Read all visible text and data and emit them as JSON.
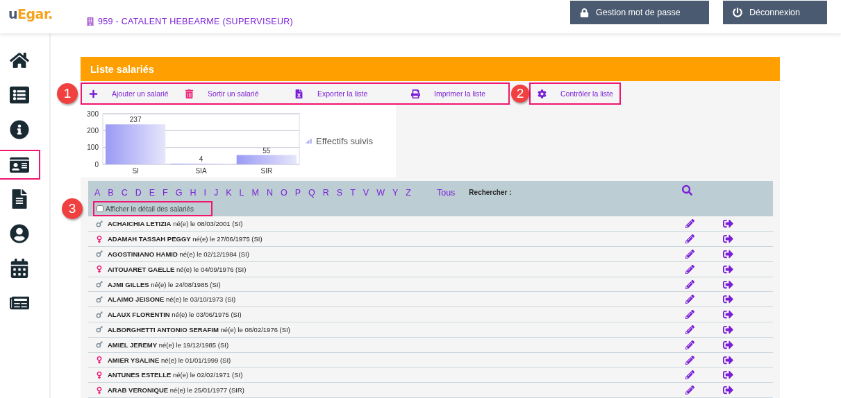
{
  "header": {
    "logo": {
      "prefix": "u",
      "rest": "Egar."
    },
    "company": "959 - CATALENT HEBEARME (SUPERVISEUR)",
    "buttons": [
      {
        "kind": "lock",
        "label": "Gestion mot de passe"
      },
      {
        "kind": "power",
        "label": "Déconnexion"
      }
    ]
  },
  "sidebar": {
    "items": [
      {
        "kind": "home",
        "highlighted": false
      },
      {
        "kind": "list",
        "highlighted": false
      },
      {
        "kind": "info",
        "highlighted": false
      },
      {
        "kind": "id-card",
        "highlighted": true
      },
      {
        "kind": "document",
        "highlighted": false
      },
      {
        "kind": "user",
        "highlighted": false
      },
      {
        "kind": "calendar",
        "highlighted": false
      },
      {
        "kind": "newspaper",
        "highlighted": false
      }
    ]
  },
  "panel": {
    "title": "Liste salariés",
    "toolbar": [
      {
        "callout": "1",
        "highlighted": true,
        "actions": [
          {
            "kind": "plus",
            "label": "Ajouter un salarié"
          },
          {
            "kind": "trash",
            "label": "Sortir un salarié"
          },
          {
            "kind": "excel",
            "label": "Exporter la liste"
          },
          {
            "kind": "print",
            "label": "Imprimer la liste"
          }
        ]
      },
      {
        "callout": "2",
        "highlighted": true,
        "actions": [
          {
            "kind": "gear",
            "label": "Contrôler la liste"
          }
        ]
      }
    ],
    "chart_data": {
      "type": "bar",
      "categories": [
        "SI",
        "SIA",
        "SIR"
      ],
      "series": [
        {
          "name": "Effectifs suivis",
          "color": "#9a9af5",
          "values": [
            237,
            4,
            55
          ]
        }
      ],
      "ylim": [
        0,
        300
      ],
      "yticks": [
        0,
        100,
        200,
        300
      ],
      "data_labels": true
    },
    "filter": {
      "letters": [
        "A",
        "B",
        "C",
        "D",
        "E",
        "F",
        "G",
        "H",
        "I",
        "J",
        "K",
        "L",
        "M",
        "N",
        "O",
        "P",
        "Q",
        "R",
        "S",
        "T",
        "V",
        "W",
        "Y",
        "Z"
      ],
      "all": "Tous",
      "search_label": "Rechercher :",
      "detail_checkbox": {
        "label": "Afficher le détail des salariés",
        "checked": false,
        "callout": "3",
        "highlighted": true
      }
    },
    "rows": [
      {
        "kind": "male",
        "name": "ACHAICHIA LETIZIA",
        "info": "né(e) le 08/03/2001 (SI)"
      },
      {
        "kind": "female",
        "name": "ADAMAH TASSAH PEGGY",
        "info": "né(e) le 27/06/1975 (SI)"
      },
      {
        "kind": "male",
        "name": "AGOSTINIANO HAMID",
        "info": "né(e) le 02/12/1984 (SI)"
      },
      {
        "kind": "female",
        "name": "AITOUARET GAELLE",
        "info": "né(e) le 04/09/1976 (SI)"
      },
      {
        "kind": "male",
        "name": "AJMI GILLES",
        "info": "né(e) le 24/08/1985 (SI)"
      },
      {
        "kind": "male",
        "name": "ALAIMO JEISONE",
        "info": "né(e) le 03/10/1973 (SI)"
      },
      {
        "kind": "male",
        "name": "ALAUX FLORENTIN",
        "info": "né(e) le 03/06/1975 (SI)"
      },
      {
        "kind": "male",
        "name": "ALBORGHETTI ANTONIO SERAFIM",
        "info": "né(e) le 08/02/1976 (SI)"
      },
      {
        "kind": "male",
        "name": "AMIEL JEREMY",
        "info": "né(e) le 19/12/1985 (SI)"
      },
      {
        "kind": "female",
        "name": "AMIER YSALINE",
        "info": "né(e) le 01/01/1999 (SI)"
      },
      {
        "kind": "female",
        "name": "ANTUNES ESTELLE",
        "info": "né(e) le 02/02/1971 (SI)"
      },
      {
        "kind": "female",
        "name": "ARAB VERONIQUE",
        "info": "né(e) le 25/01/1977 (SIR)"
      }
    ]
  }
}
